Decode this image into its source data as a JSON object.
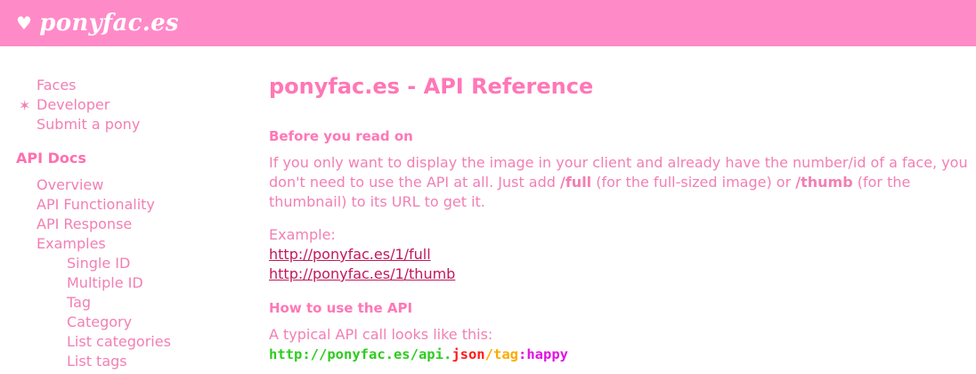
{
  "header": {
    "logo_heart": "♥",
    "logo_text": "ponyfac.es"
  },
  "sidebar": {
    "marker": "✶",
    "top_items": [
      {
        "label": "Faces"
      },
      {
        "label": "Developer"
      },
      {
        "label": "Submit a pony"
      }
    ],
    "section_title": "API Docs",
    "doc_items": [
      {
        "label": "Overview"
      },
      {
        "label": "API Functionality"
      },
      {
        "label": "API Response"
      },
      {
        "label": "Examples"
      }
    ],
    "example_items": [
      {
        "label": "Single ID"
      },
      {
        "label": "Multiple ID"
      },
      {
        "label": "Tag"
      },
      {
        "label": "Category"
      },
      {
        "label": "List categories"
      },
      {
        "label": "List tags"
      }
    ]
  },
  "main": {
    "title": "ponyfac.es - API Reference",
    "before_heading": "Before you read on",
    "before_text_1": "If you only want to display the image in your client and already have the number/id of a face, you don't need to use the API at all. Just add ",
    "before_bold_1": "/full",
    "before_text_2": " (for the full-sized image) or ",
    "before_bold_2": "/thumb",
    "before_text_3": " (for the thumbnail) to its URL to get it.",
    "example_label": "Example:",
    "example_links": [
      "http://ponyfac.es/1/full",
      "http://ponyfac.es/1/thumb"
    ],
    "howto_heading": "How to use the API",
    "howto_text": "A typical API call looks like this:",
    "api_call": {
      "base": "http://ponyfac.es/api",
      "dot": ".",
      "format": "json",
      "slash": "/",
      "key": "tag",
      "colon": ":",
      "value": "happy"
    }
  },
  "colors": {
    "header_bg": "#ff8ac8",
    "text_pink": "#f27fb4",
    "heading_pink": "#ff77b6",
    "link": "#c2185b",
    "code_green": "#2ecc1f",
    "code_red": "#ff1a1a",
    "code_orange": "#ffaa00",
    "code_magenta": "#e312e3"
  }
}
